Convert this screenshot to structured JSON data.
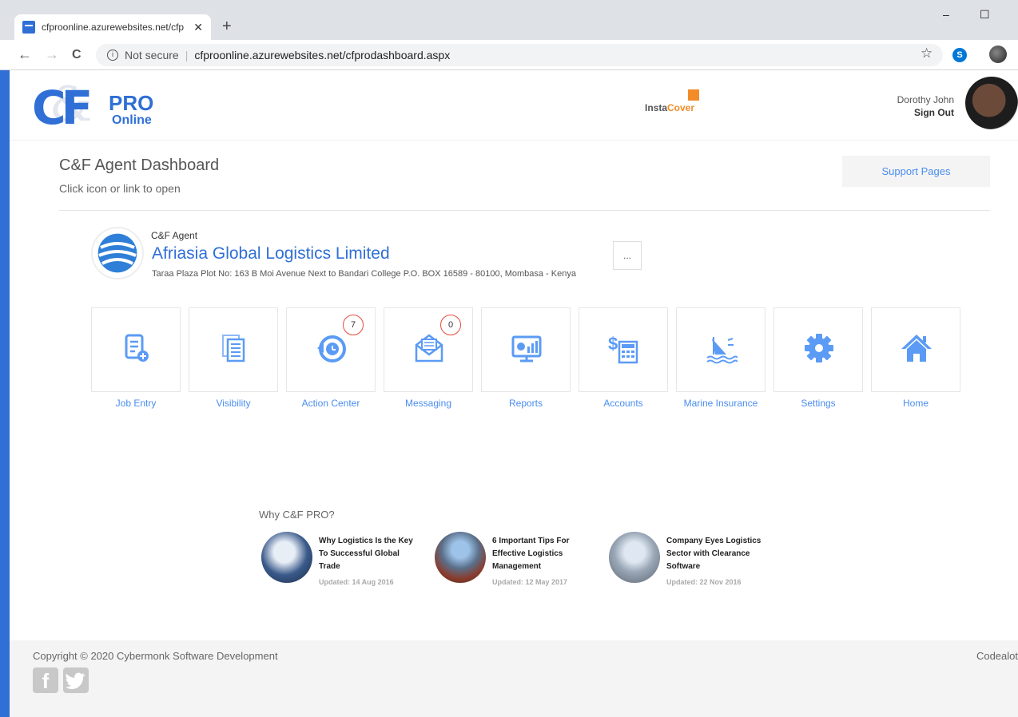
{
  "browser": {
    "tab_title": "cfproonline.azurewebsites.net/cfp",
    "tab_close": "✕",
    "new_tab": "+",
    "minimize": "–",
    "maximize": "☐",
    "back": "←",
    "forward": "→",
    "reload": "C",
    "info": "i",
    "security": "Not secure",
    "separator": "|",
    "url": "cfproonline.azurewebsites.net/cfprodashboard.aspx",
    "bookmark": "☆",
    "skype": "S"
  },
  "header": {
    "logo_letters": "CF",
    "logo_amp": "&",
    "logo_pro": "PRO",
    "logo_online": "Online",
    "insta": "Insta",
    "cover": "Cover",
    "user_name": "Dorothy John",
    "sign_out": "Sign Out"
  },
  "dashboard": {
    "title": "C&F Agent Dashboard",
    "subtitle": "Click icon or link to open",
    "support_pages": "Support Pages"
  },
  "agent": {
    "label": "C&F Agent",
    "name": "Afriasia Global Logistics Limited",
    "address": "Taraa Plaza Plot No: 163 B Moi Avenue Next to Bandari College P.O. BOX 16589 - 80100, Mombasa - Kenya",
    "more": "..."
  },
  "tiles": [
    {
      "label": "Job Entry",
      "icon": "document-add-icon"
    },
    {
      "label": "Visibility",
      "icon": "documents-icon"
    },
    {
      "label": "Action Center",
      "icon": "history-icon",
      "badge": "7"
    },
    {
      "label": "Messaging",
      "icon": "envelope-icon",
      "badge": "0"
    },
    {
      "label": "Reports",
      "icon": "monitor-chart-icon"
    },
    {
      "label": "Accounts",
      "icon": "dollar-calculator-icon"
    },
    {
      "label": "Marine Insurance",
      "icon": "ship-icon"
    },
    {
      "label": "Settings",
      "icon": "gear-icon"
    },
    {
      "label": "Home",
      "icon": "home-icon"
    }
  ],
  "why": {
    "heading": "Why C&F PRO?",
    "articles": [
      {
        "title": "Why Logistics Is the Key To Successful Global Trade",
        "date": "Updated: 14 Aug 2016"
      },
      {
        "title": "6 Important Tips For Effective Logistics Management",
        "date": "Updated: 12 May 2017"
      },
      {
        "title": "Company Eyes Logistics Sector with Clearance Software",
        "date": "Updated: 22 Nov 2016"
      }
    ]
  },
  "footer": {
    "copyright": "Copyright © 2020 Cybermonk Software Development",
    "codealot": "Codealot",
    "facebook": "f",
    "twitter": "t"
  },
  "colors": {
    "brand_blue": "#2f6fd6",
    "link_blue": "#4a8df0",
    "icon_blue": "#5b9bf5",
    "badge_red": "#e74c3c",
    "accent_orange": "#f28c28"
  }
}
